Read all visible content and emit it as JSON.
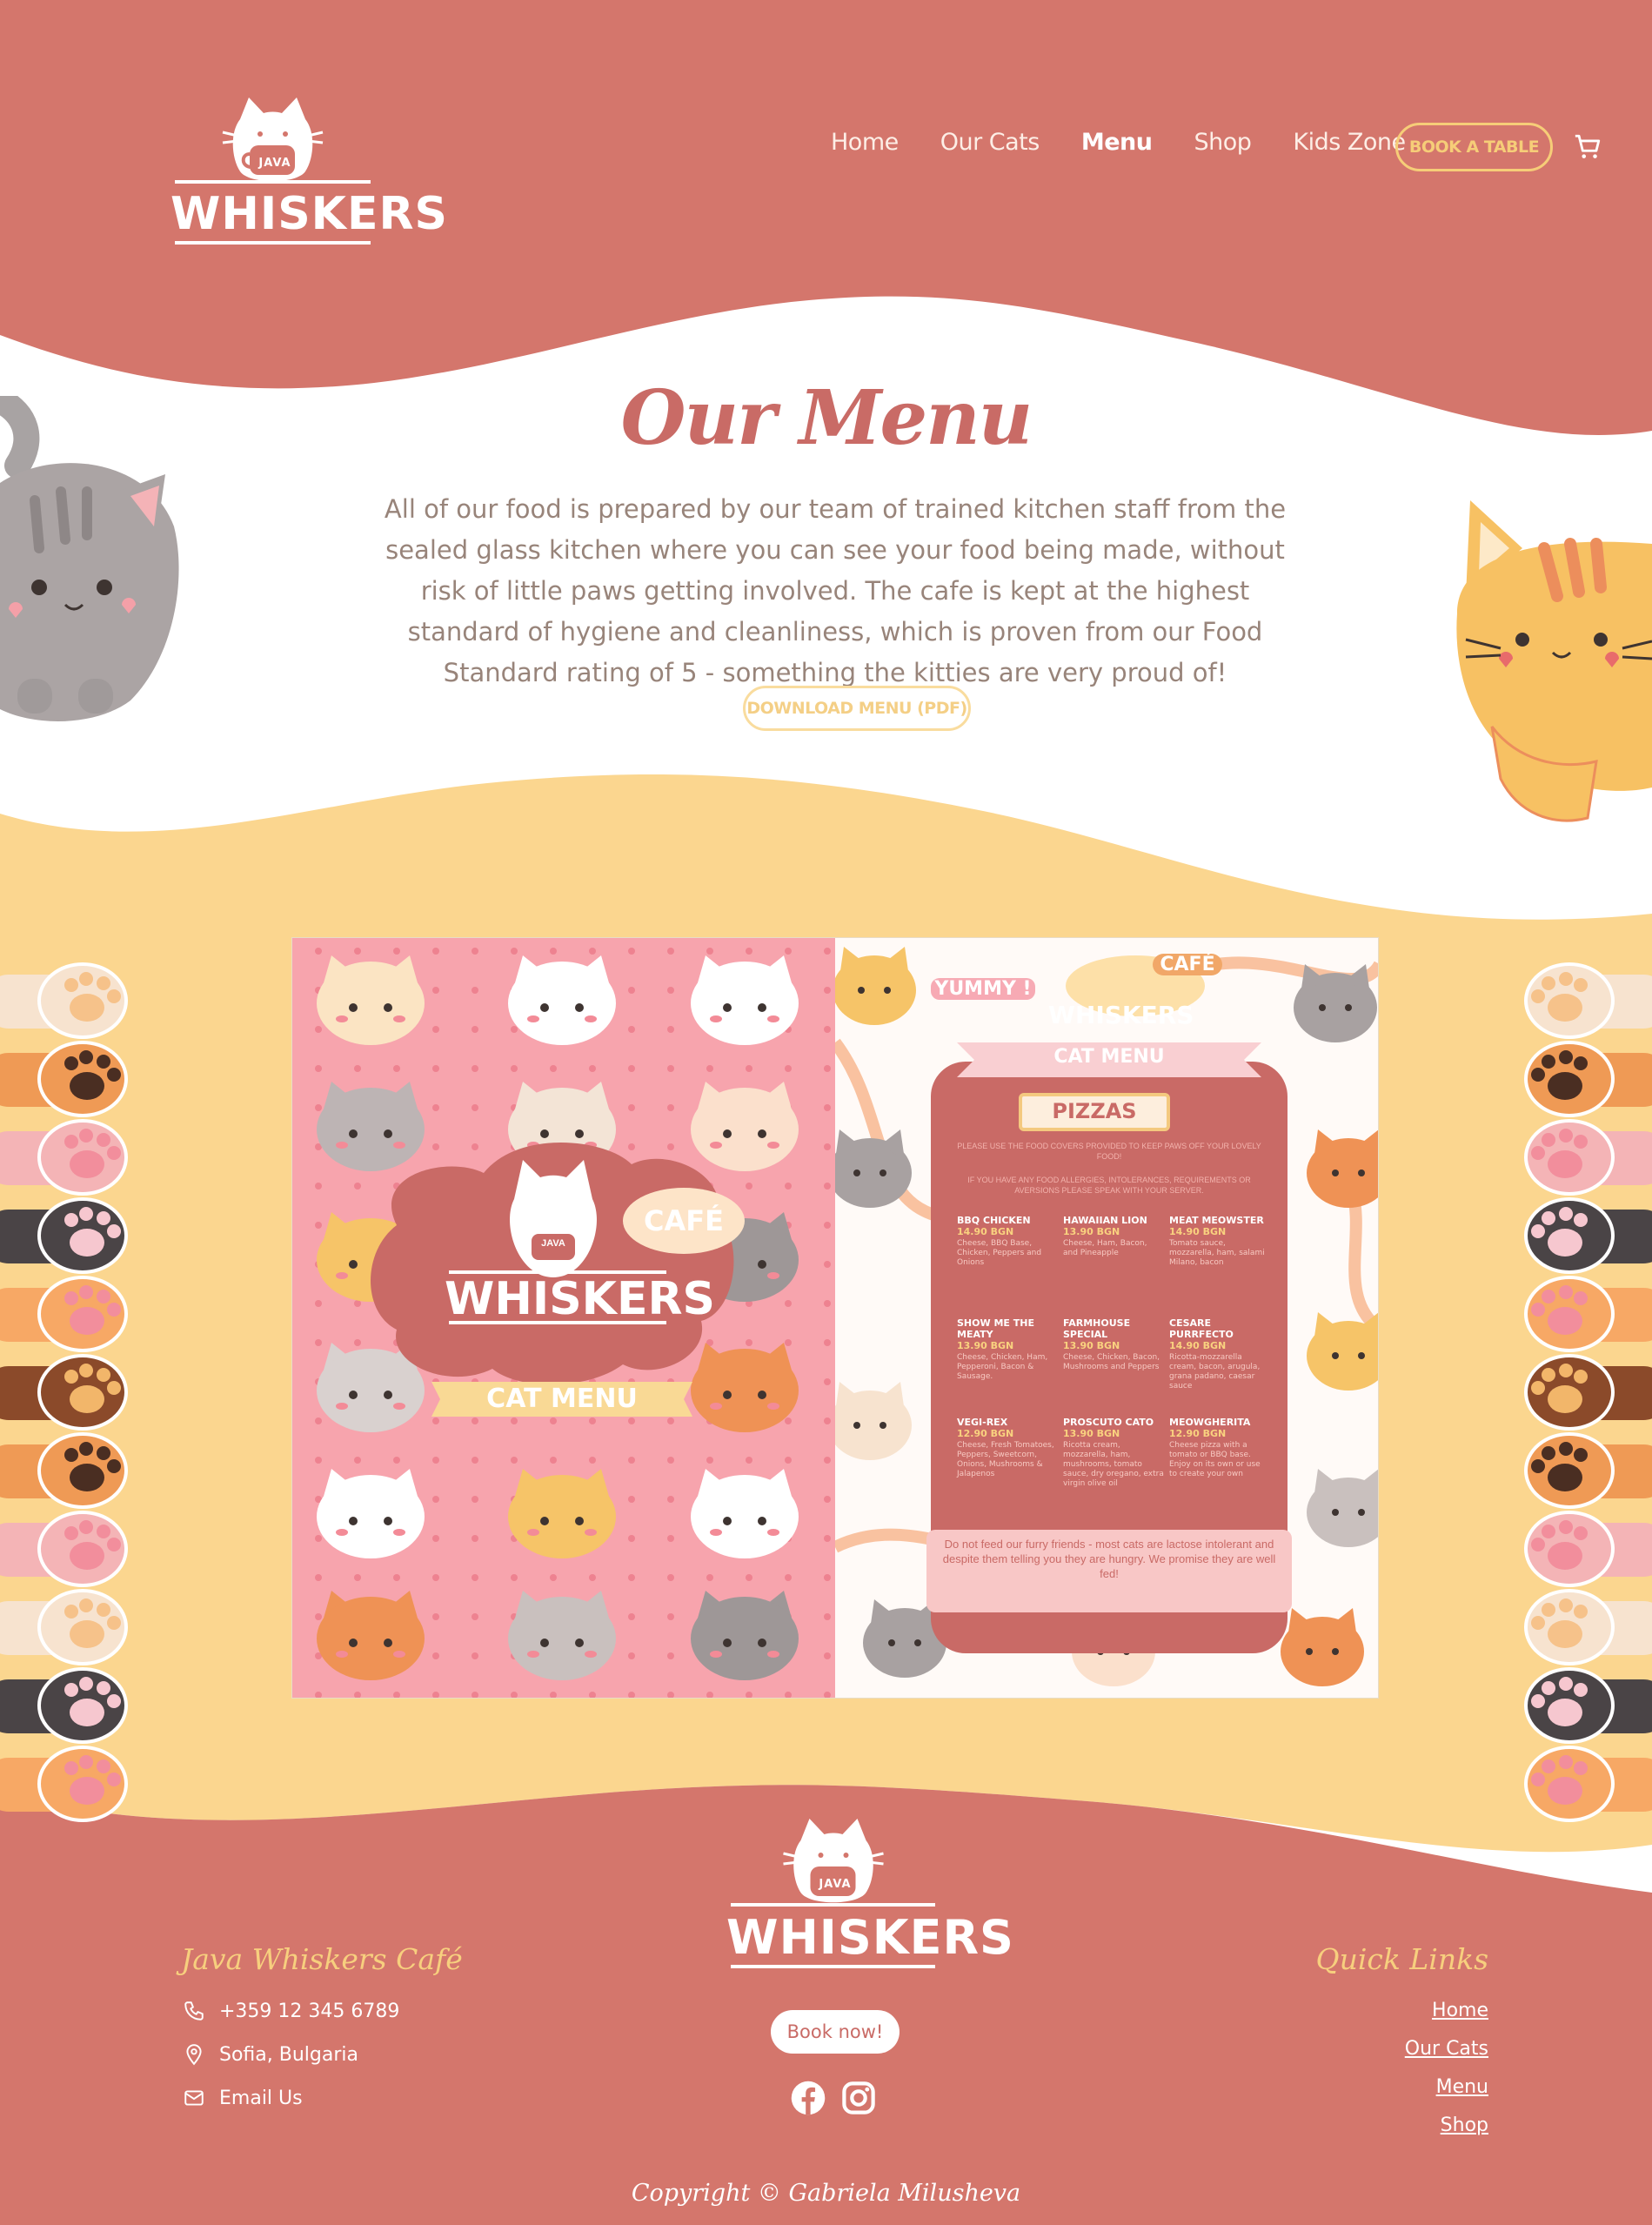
{
  "colors": {
    "primary": "#d4766c",
    "accent": "#f6cd78",
    "yellow_bg": "#fbd68f",
    "text_muted": "#98847a"
  },
  "brand": {
    "logo_small": "JAVA",
    "logo_word": "WHISKERS"
  },
  "nav": {
    "items": [
      {
        "label": "Home"
      },
      {
        "label": "Our Cats"
      },
      {
        "label": "Menu",
        "active": true
      },
      {
        "label": "Shop"
      },
      {
        "label": "Kids Zone"
      }
    ],
    "book_label": "BOOK A TABLE",
    "cart_icon": "cart-icon"
  },
  "hero": {
    "title": "Our Menu",
    "intro": "All of our food is prepared by our team of trained kitchen staff from the sealed glass kitchen where you can see your food being made, without risk of little paws getting involved. The cafe is kept at the highest standard of hygiene and cleanliness, which is proven from our Food Standard rating of 5 - something the kitties are very proud of!",
    "download_label": "DOWNLOAD MENU (PDF)"
  },
  "menu_image": {
    "cover": {
      "cafe": "CAFÉ",
      "small": "JAVA",
      "word": "WHISKERS",
      "ribbon": "CAT MENU"
    },
    "inside": {
      "yummy": "YUMMY !",
      "cafe": "CAFÉ",
      "word": "WHISKERS",
      "ribbon": "CAT MENU",
      "section": "PIZZAS",
      "note1": "PLEASE USE THE FOOD COVERS PROVIDED TO KEEP PAWS OFF YOUR LOVELY FOOD!",
      "note2": "IF YOU HAVE ANY FOOD ALLERGIES, INTOLERANCES, REQUIREMENTS OR AVERSIONS PLEASE SPEAK WITH YOUR SERVER.",
      "items": [
        {
          "name": "BBQ CHICKEN",
          "price": "14.90 BGN",
          "desc": "Cheese, BBQ Base, Chicken, Peppers and Onions"
        },
        {
          "name": "HAWAIIAN LION",
          "price": "13.90 BGN",
          "desc": "Cheese, Ham, Bacon, and Pineapple"
        },
        {
          "name": "MEAT MEOWSTER",
          "price": "14.90 BGN",
          "desc": "Tomato sauce, mozzarella, ham, salami Milano, bacon"
        },
        {
          "name": "SHOW ME THE MEATY",
          "price": "13.90 BGN",
          "desc": "Cheese, Chicken, Ham, Pepperoni, Bacon & Sausage."
        },
        {
          "name": "FARMHOUSE SPECIAL",
          "price": "13.90 BGN",
          "desc": "Cheese, Chicken, Bacon, Mushrooms and Peppers"
        },
        {
          "name": "CESARE PURRFECTO",
          "price": "14.90 BGN",
          "desc": "Ricotta-mozzarella cream, bacon, arugula, grana padano, caesar sauce"
        },
        {
          "name": "VEGI-REX",
          "price": "12.90 BGN",
          "desc": "Cheese, Fresh Tomatoes, Peppers, Sweetcorn, Onions, Mushrooms & Jalapenos"
        },
        {
          "name": "PROSCUTO CATO",
          "price": "13.90 BGN",
          "desc": "Ricotta cream, mozzarella, ham, mushrooms, tomato sauce, dry oregano, extra virgin olive oil"
        },
        {
          "name": "MEOWGHERITA",
          "price": "12.90 BGN",
          "desc": "Cheese pizza with a tomato or BBQ base. Enjoy on its own or use to create your own"
        }
      ],
      "footer_note": "Do not feed our furry friends - most cats are lactose intolerant and despite them telling you they are hungry. We promise they are well fed!"
    }
  },
  "footer": {
    "contact_title": "Java Whiskers Café",
    "phone": "+359 12 345 6789",
    "location": "Sofia, Bulgaria",
    "email": "Email Us",
    "book_now": "Book now!",
    "quick_title": "Quick Links",
    "quick_links": [
      "Home",
      "Our Cats",
      "Menu",
      "Shop"
    ],
    "copyright": "Copyright © Gabriela Milusheva",
    "icons": [
      "phone-icon",
      "location-icon",
      "mail-icon",
      "facebook-icon",
      "instagram-icon"
    ]
  }
}
